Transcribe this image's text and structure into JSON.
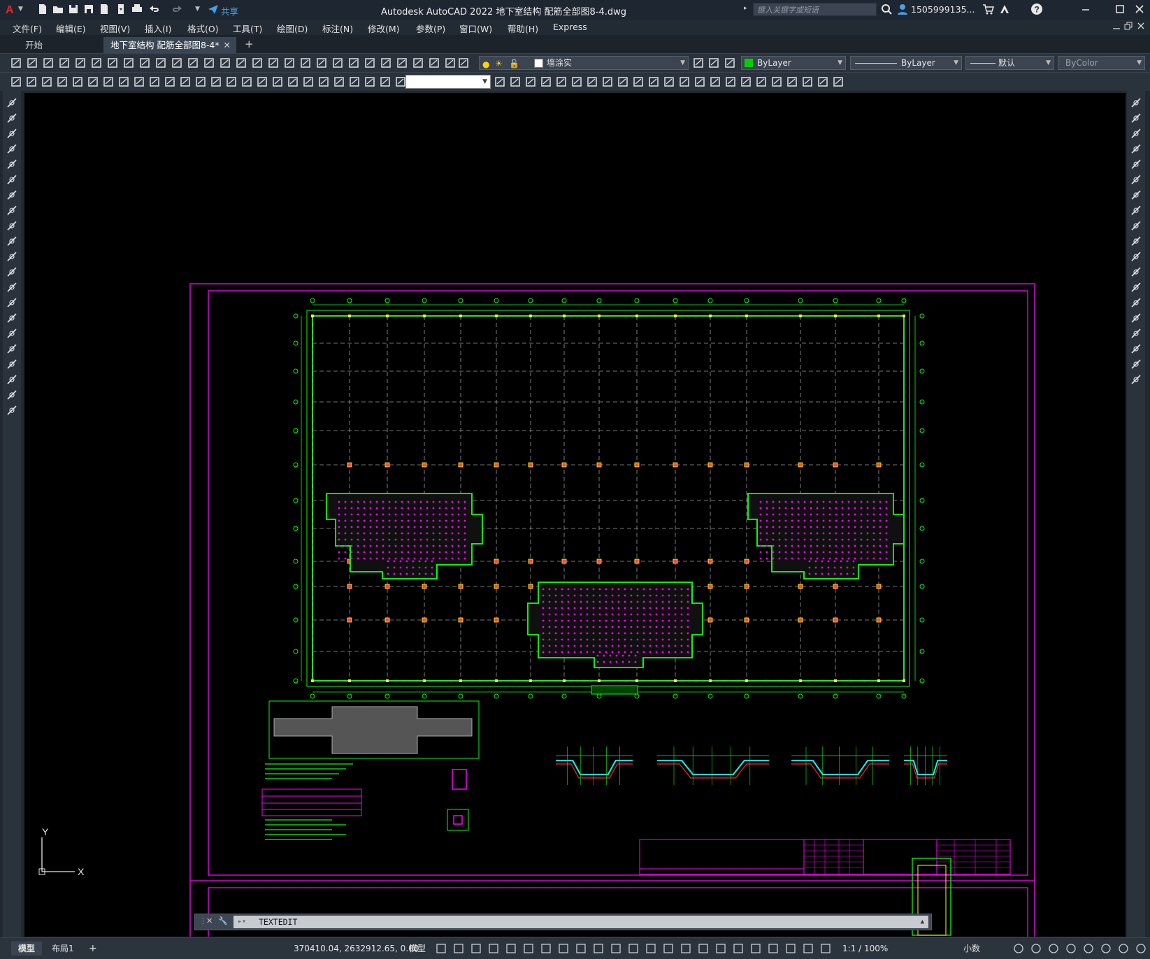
{
  "title_bar": {
    "app_icon": "autocad-a-icon",
    "title": "Autodesk AutoCAD 2022    地下室结构 配筋全部图8-4.dwg",
    "share_label": "共享",
    "search_placeholder": "键入关键字或短语",
    "user": "1505999135...",
    "window_controls": [
      "minimize-icon",
      "maximize-icon",
      "close-icon"
    ]
  },
  "menu": {
    "items": [
      "文件(F)",
      "编辑(E)",
      "视图(V)",
      "插入(I)",
      "格式(O)",
      "工具(T)",
      "绘图(D)",
      "标注(N)",
      "修改(M)",
      "参数(P)",
      "窗口(W)",
      "帮助(H)",
      "Express"
    ]
  },
  "tabs": {
    "items": [
      "开始",
      "地下室结构 配筋全部图8-4*"
    ],
    "active_index": 1,
    "add_label": "+"
  },
  "toolbar": {
    "layer_name": "墙涂实",
    "color": "ByLayer",
    "color_swatch": "#00d000",
    "linetype": "ByLayer",
    "lineweight": "默认",
    "plotstyle": "ByColor"
  },
  "command_line": {
    "text": "TEXTEDIT"
  },
  "status_bar": {
    "tabs": [
      "模型",
      "布局1"
    ],
    "add_label": "+",
    "coordinates": "370410.04, 2632912.65, 0.00",
    "space": "模型",
    "scale": "1:1 / 100%",
    "units": "小数"
  },
  "ucs": {
    "y_label": "Y",
    "x_label": "X"
  },
  "colors": {
    "canvas": "#000000",
    "frame": "#ff00ff",
    "wall": "#00ff00",
    "column": "#ffff00",
    "axis": "#ffffff"
  }
}
